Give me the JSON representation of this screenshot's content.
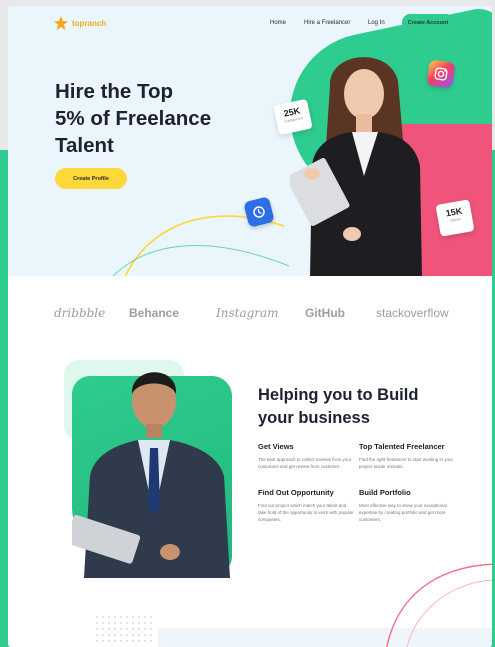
{
  "brand": {
    "name": "topranch",
    "accent": "#f2a91e"
  },
  "nav": {
    "links": [
      "Home",
      "Hire a Freelancer",
      "Log In"
    ],
    "cta_label": "Create Account"
  },
  "hero": {
    "title_lines": [
      "Hire the Top",
      "5% of Freelance",
      "Talent"
    ],
    "cta_label": "Create Profile",
    "stat_card_1": {
      "value": "25K",
      "sub": "Freelancers"
    },
    "stat_card_2": {
      "value": "15K",
      "sub": "Clients"
    },
    "icons": [
      "instagram-icon",
      "blue-app-icon"
    ]
  },
  "logos": [
    "dribbble",
    "Behance",
    "Instagram",
    "GitHub",
    "stackoverflow"
  ],
  "features": {
    "title_lines": [
      "Helping you to Build",
      "your business"
    ],
    "items": [
      {
        "title": "Get Views",
        "text": "The best approach to collect reviews from your customers and get review from customer."
      },
      {
        "title": "Top Talented Freelancer",
        "text": "Find the right freelancer to start working in your project inside minutes."
      },
      {
        "title": "Find Out Opportunity",
        "text": "Find out project which match your talent and take hold of the opportunity to work with popular companies."
      },
      {
        "title": "Build Portfolio",
        "text": "Most effective way to show your exceptional expertise by creating portfolio and get more customers."
      }
    ]
  },
  "colors": {
    "green": "#2ecc8e",
    "pink": "#f0547a",
    "yellow": "#fdd83a",
    "dark": "#1e2230"
  }
}
